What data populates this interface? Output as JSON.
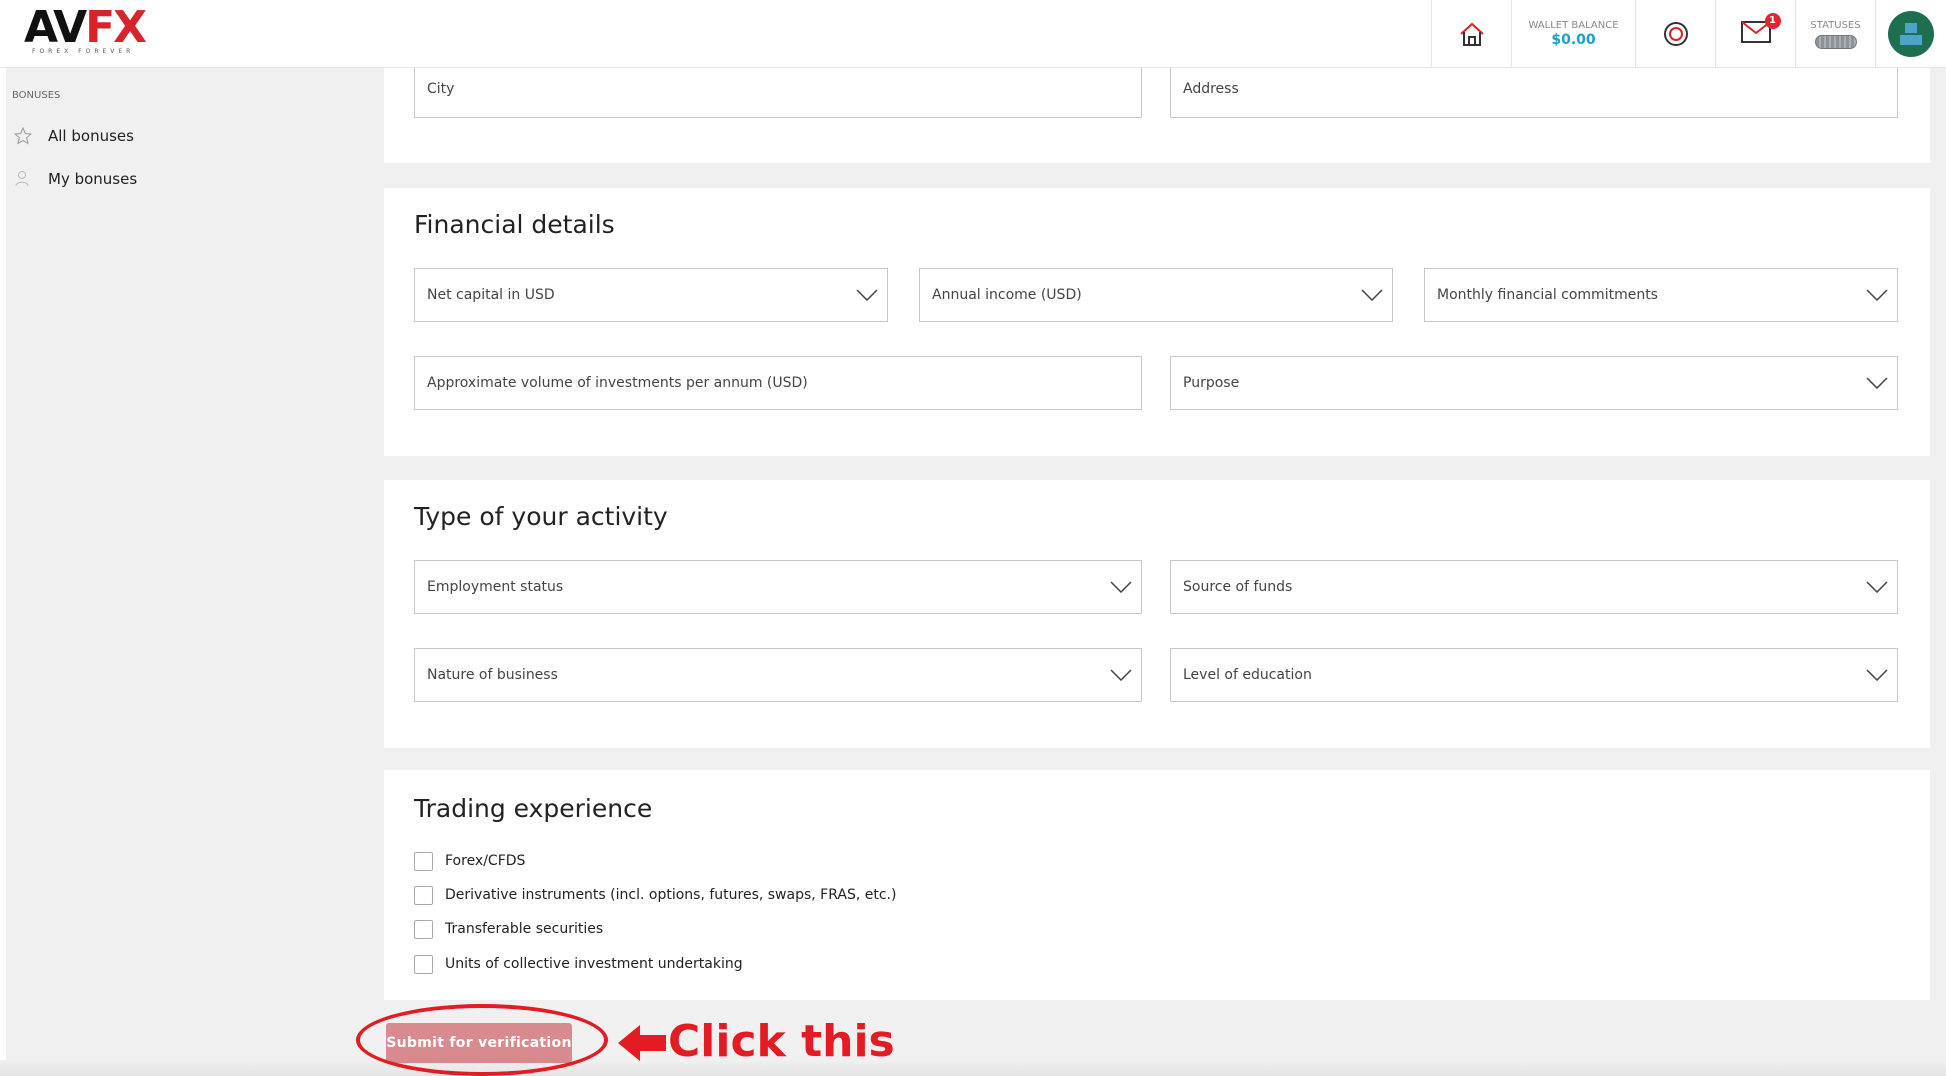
{
  "brand": {
    "logo_text_main": "AV",
    "logo_text_accent": "FX",
    "tagline": "FOREX FOREVER"
  },
  "header": {
    "wallet_label": "WALLET BALANCE",
    "wallet_value": "$0.00",
    "statuses_label": "STATUSES",
    "mail_badge": "1"
  },
  "sidebar": {
    "heading": "BONUSES",
    "items": [
      {
        "label": "All bonuses",
        "icon": "star-icon"
      },
      {
        "label": "My bonuses",
        "icon": "user-icon"
      }
    ]
  },
  "address_section": {
    "city_placeholder": "City",
    "address_placeholder": "Address"
  },
  "financial": {
    "title": "Financial details",
    "net_capital": "Net capital in USD",
    "annual_income": "Annual income (USD)",
    "monthly_commitments": "Monthly financial commitments",
    "investment_volume": "Approximate volume of investments per annum (USD)",
    "purpose": "Purpose"
  },
  "activity": {
    "title": "Type of your activity",
    "employment_status": "Employment status",
    "source_of_funds": "Source of funds",
    "nature_of_business": "Nature of business",
    "level_of_education": "Level of education"
  },
  "trading": {
    "title": "Trading experience",
    "options": [
      "Forex/CFDS",
      "Derivative instruments (incl. options, futures, swaps, FRAS, etc.)",
      "Transferable securities",
      "Units of collective investment undertaking"
    ]
  },
  "submit_label": "Submit for verification",
  "annotation_text": "Click this",
  "colors": {
    "accent_red": "#e31b23",
    "wallet_blue": "#1aa1c9",
    "submit_bg": "#d88a8f"
  }
}
